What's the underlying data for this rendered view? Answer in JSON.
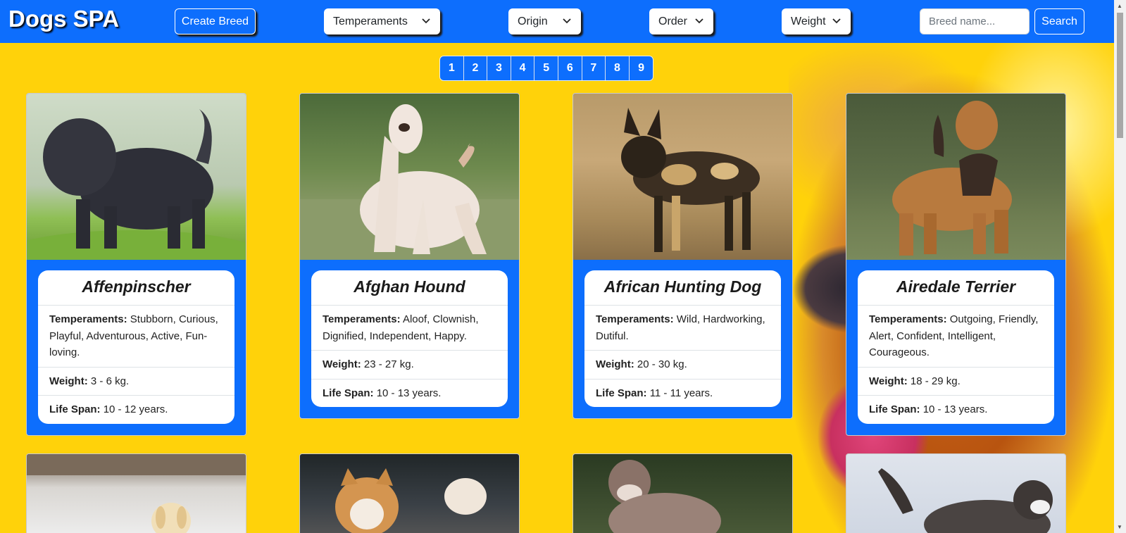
{
  "navbar": {
    "brand": "Dogs SPA",
    "create_button": "Create Breed",
    "filters": {
      "temperaments": "Temperaments",
      "origin": "Origin",
      "order": "Order",
      "weight": "Weight"
    },
    "search_placeholder": "Breed name...",
    "search_button": "Search"
  },
  "pagination": [
    "1",
    "2",
    "3",
    "4",
    "5",
    "6",
    "7",
    "8",
    "9"
  ],
  "labels": {
    "temperaments": "Temperaments:",
    "weight": "Weight:",
    "life_span": "Life Span:"
  },
  "cards": [
    {
      "name": "Affenpinscher",
      "temperaments": "Stubborn, Curious, Playful, Adventurous, Active, Fun-loving.",
      "weight": "3 - 6 kg.",
      "life_span": "10 - 12 years."
    },
    {
      "name": "Afghan Hound",
      "temperaments": "Aloof, Clownish, Dignified, Independent, Happy.",
      "weight": "23 - 27 kg.",
      "life_span": "10 - 13 years."
    },
    {
      "name": "African Hunting Dog",
      "temperaments": "Wild, Hardworking, Dutiful.",
      "weight": "20 - 30 kg.",
      "life_span": "11 - 11 years."
    },
    {
      "name": "Airedale Terrier",
      "temperaments": "Outgoing, Friendly, Alert, Confident, Intelligent, Courageous.",
      "weight": "18 - 29 kg.",
      "life_span": "10 - 13 years."
    }
  ],
  "colors": {
    "primary": "#0d6efd",
    "background": "#ffd20a"
  }
}
